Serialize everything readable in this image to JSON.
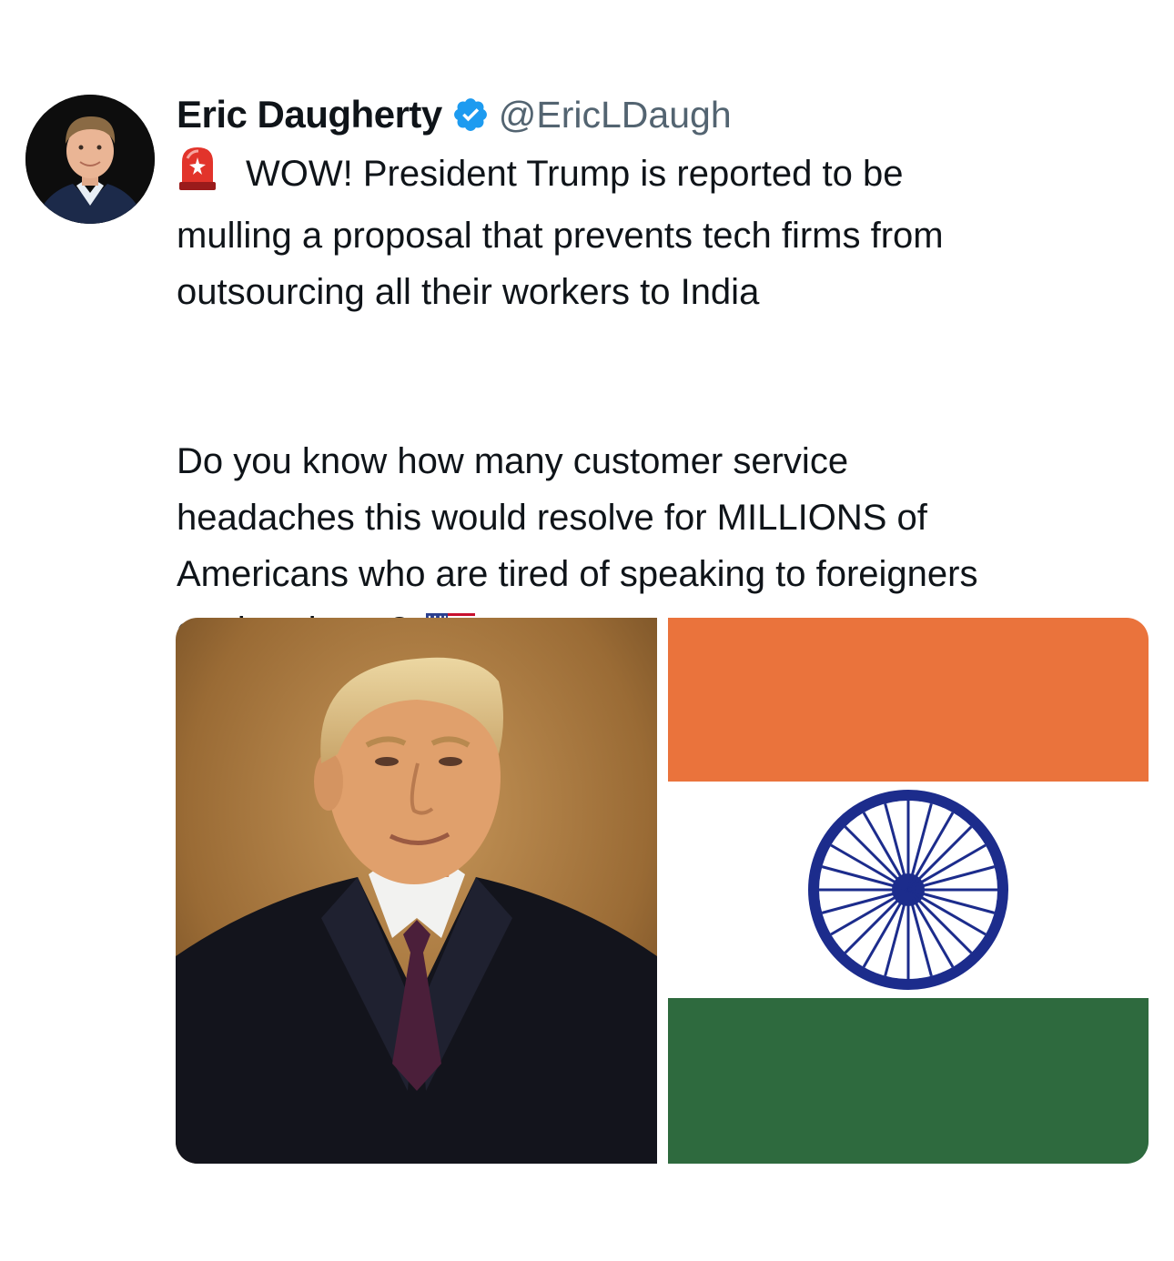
{
  "tweet": {
    "author": {
      "display_name": "Eric Daugherty",
      "handle": "@EricLDaugh",
      "verified": true,
      "verified_color": "#1d9bf0",
      "avatar_icon": "profile-photo"
    },
    "text": {
      "paragraph1": [
        "WOW! President Trump is reported to be",
        "mulling a proposal that prevents tech firms from",
        "outsourcing all their workers to India"
      ],
      "paragraph2": [
        "Do you know how many customer service",
        "headaches this would resolve for MILLIONS of",
        "Americans who are tired of speaking to foreigners",
        "on the phone?"
      ],
      "leading_emoji": "rotating-light-emoji",
      "trailing_emoji": "us-flag-emoji"
    },
    "media": [
      {
        "kind": "photo",
        "subject": "portrait-photo"
      },
      {
        "kind": "photo",
        "subject": "india-flag",
        "colors": {
          "saffron": "#ea733c",
          "white": "#ffffff",
          "green": "#2e6a3e",
          "chakra": "#1c2c8c"
        }
      }
    ]
  }
}
